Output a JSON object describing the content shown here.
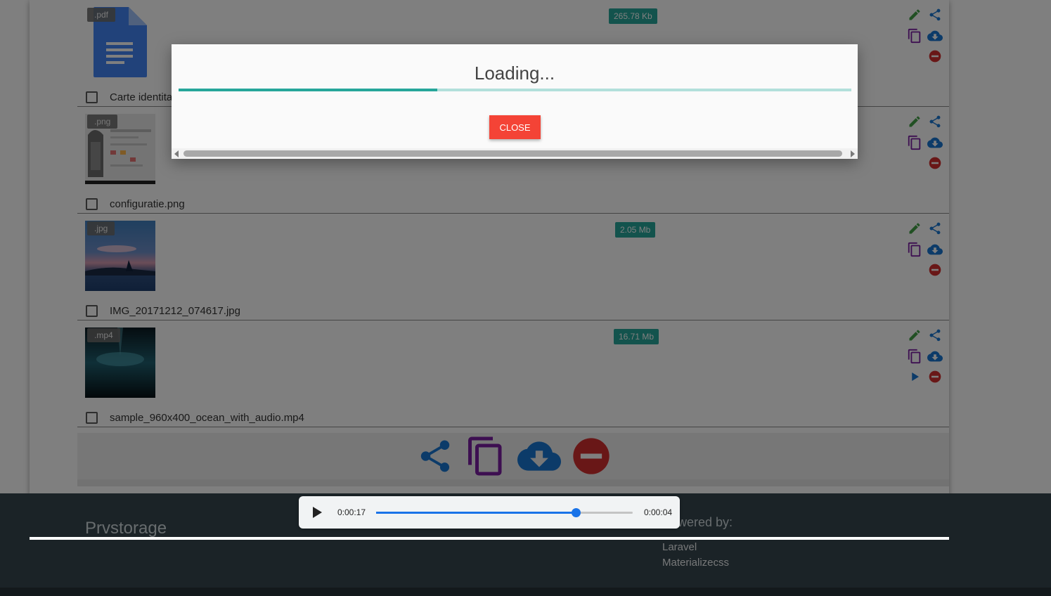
{
  "files": [
    {
      "ext": ".pdf",
      "name": "Carte identita",
      "size": "265.78 Kb",
      "thumb": "pdf-doc-icon",
      "has_play": false
    },
    {
      "ext": ".png",
      "name": "configuratie.png",
      "size": "",
      "thumb": "screenshot-thumbnail",
      "has_play": false
    },
    {
      "ext": ".jpg",
      "name": "IMG_20171212_074617.jpg",
      "size": "2.05 Mb",
      "thumb": "sunset-photo-thumbnail",
      "has_play": false
    },
    {
      "ext": ".mp4",
      "name": "sample_960x400_ocean_with_audio.mp4",
      "size": "16.71 Mb",
      "thumb": "ocean-video-thumbnail",
      "has_play": true
    }
  ],
  "modal": {
    "title": "Loading...",
    "close_label": "CLOSE",
    "progress_fraction": 0.385
  },
  "player": {
    "current_time": "0:00:17",
    "remaining_time": "0:00:04",
    "progress_fraction": 0.778
  },
  "footer": {
    "brand": "Prvstorage",
    "powered_by": "Powered by:",
    "links": [
      "Laravel",
      "Materializecss"
    ]
  },
  "colors": {
    "edit": "#43a047",
    "share": "#1976d2",
    "copy": "#7b1fa2",
    "download": "#1976d2",
    "delete": "#d32f2f",
    "accent": "#26a69a"
  }
}
